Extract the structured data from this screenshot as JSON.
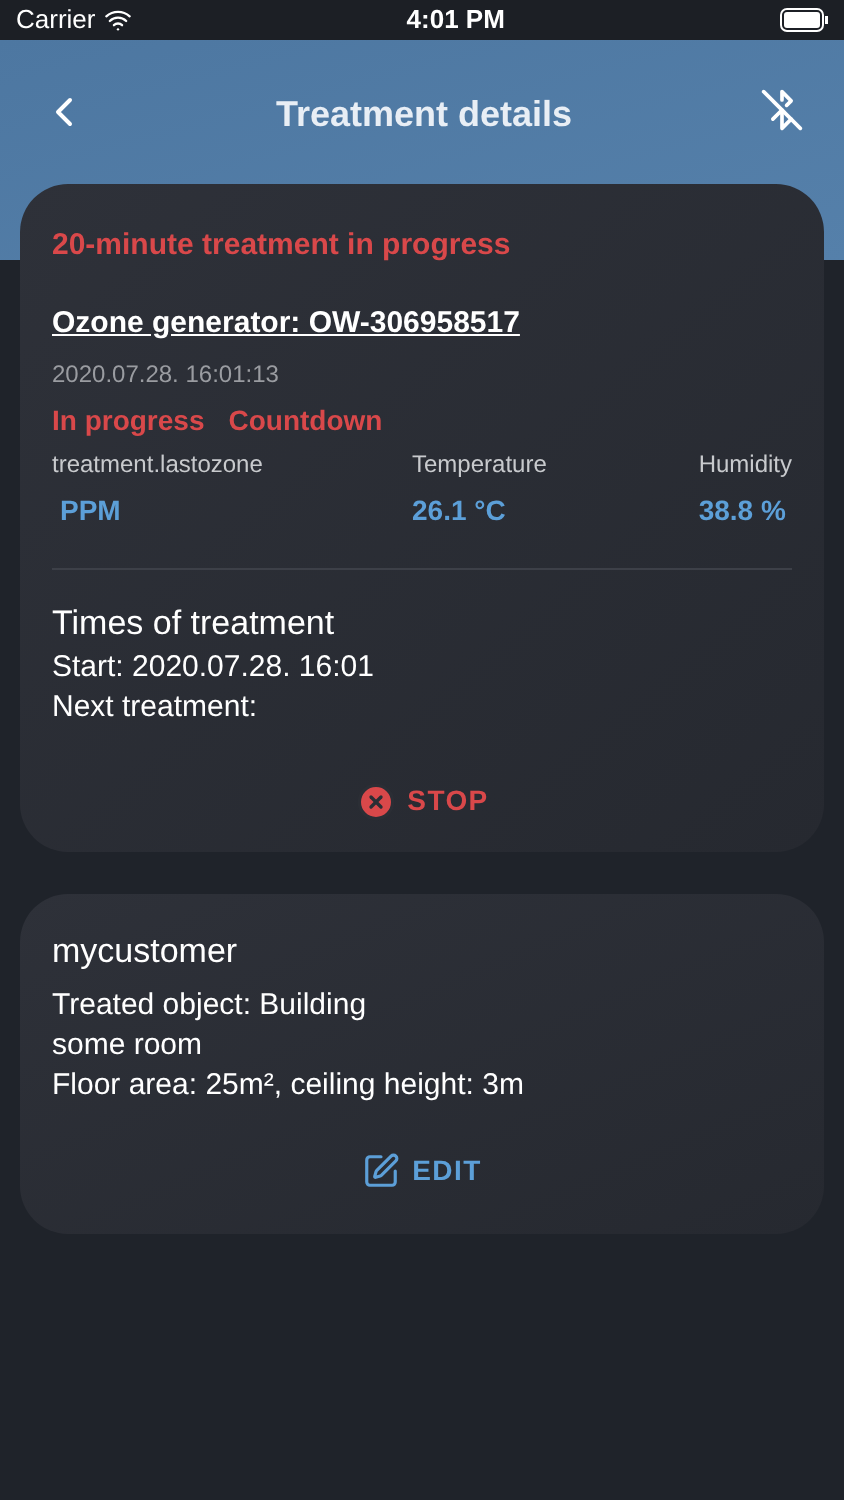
{
  "status_bar": {
    "carrier": "Carrier",
    "time": "4:01 PM"
  },
  "header": {
    "title": "Treatment details"
  },
  "treatment_card": {
    "banner": "20-minute treatment in progress",
    "device": "Ozone generator: OW-306958517",
    "timestamp": "2020.07.28. 16:01:13",
    "statuses": [
      "In progress",
      "Countdown"
    ],
    "metrics": [
      {
        "label": "treatment.lastozone",
        "value": "PPM"
      },
      {
        "label": "Temperature",
        "value": "26.1 °C"
      },
      {
        "label": "Humidity",
        "value": "38.8 %"
      }
    ],
    "times_title": "Times of treatment",
    "times": [
      "Start: 2020.07.28. 16:01",
      "Next treatment:"
    ],
    "stop_button": "STOP"
  },
  "customer_card": {
    "name": "mycustomer",
    "lines": [
      "Treated object: Building",
      "some room",
      "Floor area: 25m², ceiling height: 3m"
    ],
    "edit_button": "EDIT"
  }
}
